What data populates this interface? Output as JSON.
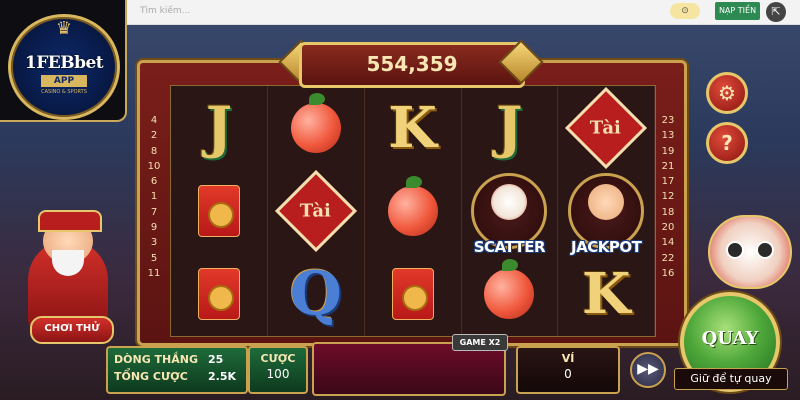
{
  "browser": {
    "search_placeholder": "Tìm kiếm...",
    "deposit_label": "NẠP TIỀN",
    "external_icon": "external-link-icon"
  },
  "logo": {
    "brand": "1FEBbet",
    "app_label": "APP",
    "tagline": "CASINO & SPORTS"
  },
  "jackpot": {
    "value": "554,359"
  },
  "reels": [
    [
      "J",
      "envelope",
      "envelope"
    ],
    [
      "peach",
      "tai",
      "Q"
    ],
    [
      "K",
      "peach",
      "envelope"
    ],
    [
      "J",
      "scatter",
      "peach"
    ],
    [
      "tai",
      "jackpot",
      "K"
    ]
  ],
  "symbol_labels": {
    "tai": "Tài",
    "scatter": "SCATTER",
    "jackpot": "JACKPOT"
  },
  "left_lines": [
    "4",
    "2",
    "8",
    "10",
    "6",
    "1",
    "7",
    "9",
    "3",
    "5",
    "11"
  ],
  "right_lines": [
    "23",
    "13",
    "19",
    "21",
    "17",
    "12",
    "18",
    "20",
    "14",
    "22",
    "16"
  ],
  "character": {
    "try_label": "CHƠI THỬ"
  },
  "stats": {
    "winning_lines_label": "DÒNG THẮNG",
    "winning_lines_value": "25",
    "total_bet_label": "TỔNG CƯỢC",
    "total_bet_value": "2.5K"
  },
  "bet": {
    "label": "CƯỢC",
    "value": "100"
  },
  "wallet": {
    "label": "VÍ",
    "value": "0"
  },
  "game_mode": "GAME X2",
  "spin": {
    "label": "QUAY",
    "hold_label": "Giữ để tự quay"
  },
  "colors": {
    "frame": "#7a1e1a",
    "gold": "#c9a14f",
    "spin_green": "#4fa83a"
  }
}
